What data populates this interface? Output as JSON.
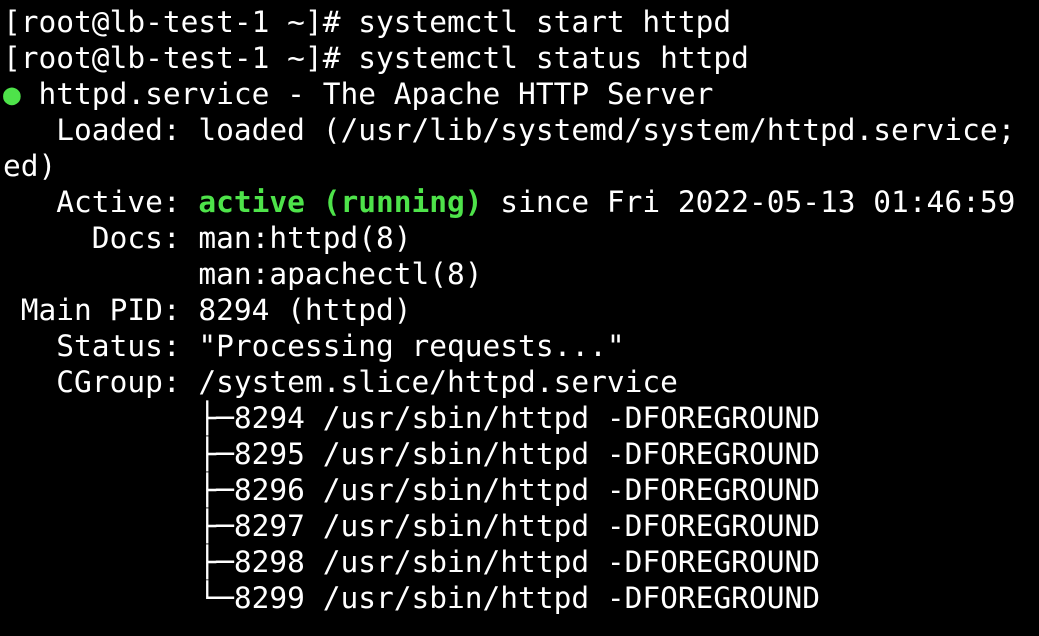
{
  "colors": {
    "background": "#000000",
    "text": "#ffffff",
    "active_green": "#4ee34a"
  },
  "lines": {
    "l1": "[root@lb-test-1 ~]# systemctl start httpd",
    "l2": "[root@lb-test-1 ~]# systemctl status httpd",
    "l3_bullet": "●",
    "l3_text": " httpd.service - The Apache HTTP Server",
    "l4": "   Loaded: loaded (/usr/lib/systemd/system/httpd.service;",
    "l5": "ed)",
    "l6_label": "   Active: ",
    "l6_status": "active (running)",
    "l6_rest": " since Fri 2022-05-13 01:46:59",
    "l7": "     Docs: man:httpd(8)",
    "l8": "           man:apachectl(8)",
    "l9": " Main PID: 8294 (httpd)",
    "l10": "   Status: \"Processing requests...\"",
    "l11": "   CGroup: /system.slice/httpd.service",
    "l12": "           ├─8294 /usr/sbin/httpd -DFOREGROUND",
    "l13": "           ├─8295 /usr/sbin/httpd -DFOREGROUND",
    "l14": "           ├─8296 /usr/sbin/httpd -DFOREGROUND",
    "l15": "           ├─8297 /usr/sbin/httpd -DFOREGROUND",
    "l16": "           ├─8298 /usr/sbin/httpd -DFOREGROUND",
    "l17": "           └─8299 /usr/sbin/httpd -DFOREGROUND"
  }
}
